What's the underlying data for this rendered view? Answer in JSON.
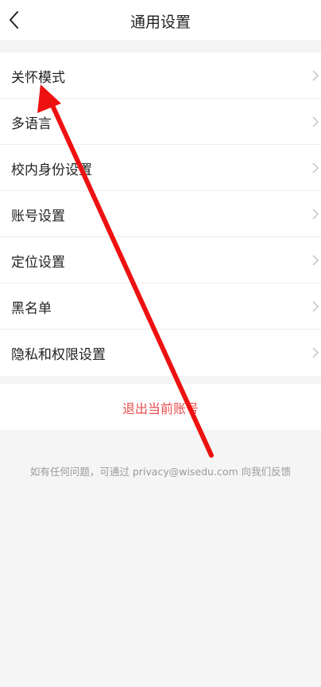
{
  "header": {
    "title": "通用设置"
  },
  "settings": {
    "items": [
      {
        "label": "关怀模式"
      },
      {
        "label": "多语言"
      },
      {
        "label": "校内身份设置"
      },
      {
        "label": "账号设置"
      },
      {
        "label": "定位设置"
      },
      {
        "label": "黑名单"
      },
      {
        "label": "隐私和权限设置"
      }
    ]
  },
  "logout": {
    "label": "退出当前账号"
  },
  "footer": {
    "note": "如有任何问题，可通过 privacy@wisedu.com 向我们反馈"
  },
  "icons": {
    "back": "chevron-left-icon",
    "row_arrow": "chevron-right-icon"
  },
  "colors": {
    "page_bg": "#f5f5f5",
    "danger": "#e84d4d",
    "annotation_arrow": "#ee1111"
  }
}
